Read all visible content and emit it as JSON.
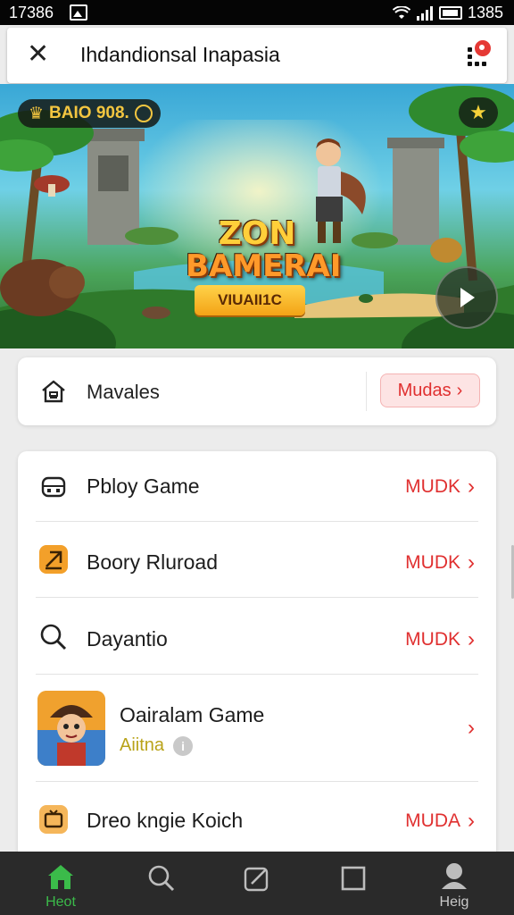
{
  "status_bar": {
    "time": "17386",
    "right_time": "1385"
  },
  "header": {
    "title": "Ihdandionsal Inapasia"
  },
  "banner": {
    "coins": "BAIO 908.",
    "game_title_line1": "ZON",
    "game_title_line2": "BAMERAI",
    "cta_label": "VIUAII1C"
  },
  "favorites": {
    "label": "Mavales",
    "action_label": "Mudas"
  },
  "list": {
    "items": [
      {
        "label": "Pbloy Game",
        "tag": "MUDK",
        "icon": "console-icon"
      },
      {
        "label": "Boory Rluroad",
        "tag": "MUDK",
        "icon": "download-icon"
      },
      {
        "label": "Dayantio",
        "tag": "MUDK",
        "icon": "search-icon"
      },
      {
        "label": "Oairalam Game",
        "subtitle": "Aiitna",
        "icon": "game-thumbnail"
      },
      {
        "label": "Dreo kngie Koich",
        "tag": "MUDA",
        "icon": "tv-icon"
      }
    ]
  },
  "bottom_nav": {
    "items": [
      {
        "label": "Heot",
        "icon": "home-icon",
        "active": true
      },
      {
        "label": "",
        "icon": "search-icon"
      },
      {
        "label": "",
        "icon": "edit-icon"
      },
      {
        "label": "",
        "icon": "square-icon"
      },
      {
        "label": "Heig",
        "icon": "profile-icon"
      }
    ]
  },
  "colors": {
    "accent_red": "#e03030",
    "nav_active": "#3bbb4a",
    "coin_gold": "#f3c640"
  }
}
